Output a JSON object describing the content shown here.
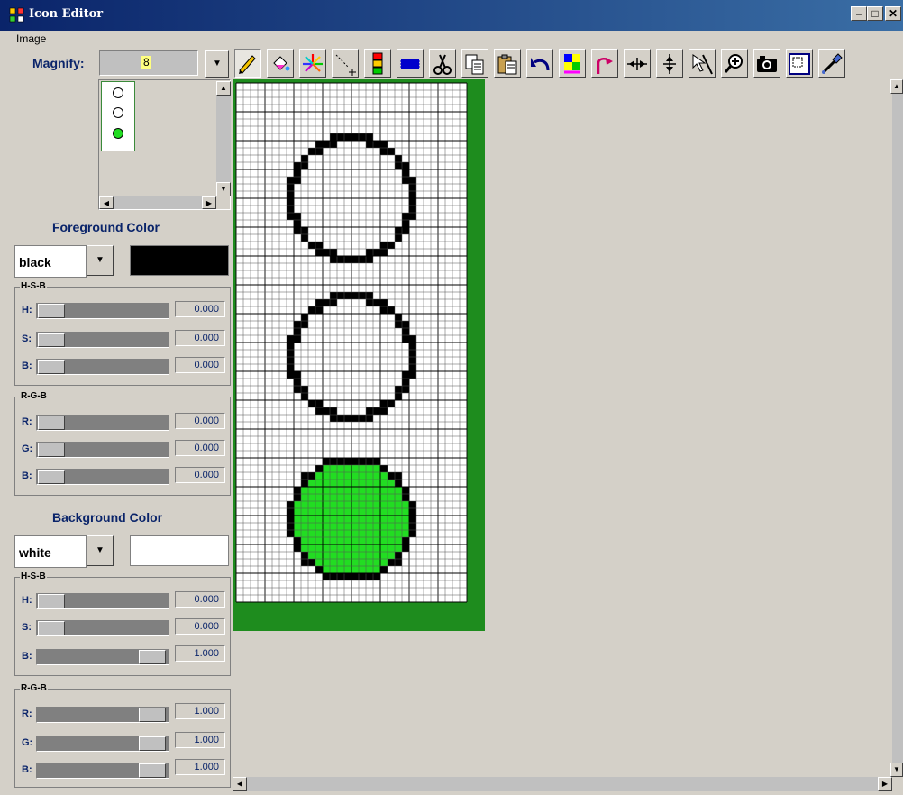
{
  "window": {
    "title": "Icon Editor",
    "controls": [
      "minimize",
      "maximize",
      "close"
    ]
  },
  "menu": {
    "items": [
      "Image"
    ]
  },
  "magnify": {
    "label": "Magnify:",
    "value": "8"
  },
  "toolbar": {
    "tools": [
      "pencil-icon",
      "fill-bucket-icon",
      "spray-icon",
      "line-icon",
      "color-replace-icon",
      "rectangle-select-icon",
      "cut-icon",
      "copy-icon",
      "paste-icon",
      "undo-icon",
      "color-swap-icon",
      "rotate-icon",
      "flip-horizontal-icon",
      "flip-vertical-icon",
      "pointer-icon",
      "zoom-icon",
      "camera-icon",
      "select-region-icon",
      "eyedropper-icon"
    ]
  },
  "foreground": {
    "title": "Foreground Color",
    "color_name": "black",
    "swatch_color": "#000000",
    "hsb": {
      "group_label": "H-S-B",
      "h_label": "H:",
      "h_value": "0.000",
      "s_label": "S:",
      "s_value": "0.000",
      "b_label": "B:",
      "b_value": "0.000"
    },
    "rgb": {
      "group_label": "R-G-B",
      "r_label": "R:",
      "r_value": "0.000",
      "g_label": "G:",
      "g_value": "0.000",
      "b_label": "B:",
      "b_value": "0.000"
    }
  },
  "background": {
    "title": "Background Color",
    "color_name": "white",
    "swatch_color": "#ffffff",
    "hsb": {
      "group_label": "H-S-B",
      "h_label": "H:",
      "h_value": "0.000",
      "s_label": "S:",
      "s_value": "0.000",
      "b_label": "B:",
      "b_value": "1.000"
    },
    "rgb": {
      "group_label": "R-G-B",
      "r_label": "R:",
      "r_value": "1.000",
      "g_label": "G:",
      "g_value": "1.000",
      "b_label": "B:",
      "b_value": "1.000"
    }
  },
  "icon_image": {
    "grid_cols": 32,
    "grid_rows": 72,
    "frame_color": "#1e8c1e",
    "light_fill": "#ffffff",
    "green_fill": "#22dd22",
    "outline_color": "#000000",
    "lights": [
      "off",
      "off",
      "green"
    ]
  },
  "colors": {
    "titlebar_start": "#0a246a",
    "titlebar_end": "#3a6ea5",
    "label_blue": "#0a246a",
    "face": "#d4d0c8"
  }
}
